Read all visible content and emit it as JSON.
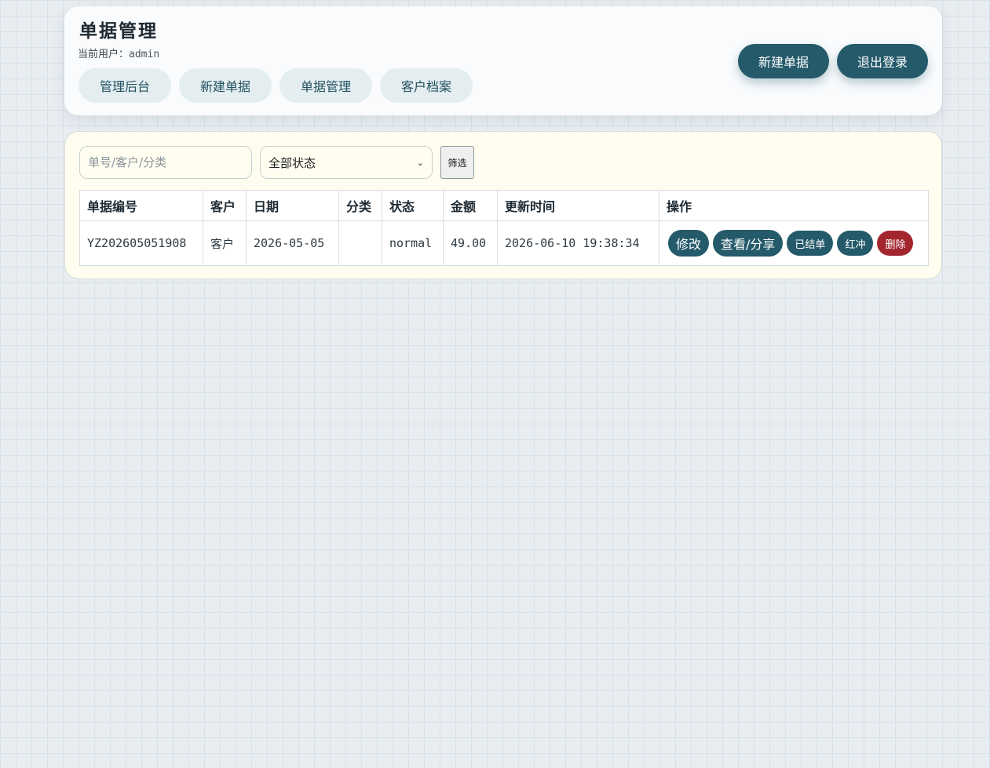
{
  "header": {
    "title": "单据管理",
    "user_label": "当前用户：",
    "user_name": "admin",
    "nav": [
      {
        "label": "管理后台"
      },
      {
        "label": "新建单据"
      },
      {
        "label": "单据管理"
      },
      {
        "label": "客户档案"
      }
    ],
    "actions": {
      "new_label": "新建单据",
      "logout_label": "退出登录"
    }
  },
  "filter": {
    "search_placeholder": "单号/客户/分类",
    "status_value": "全部状态",
    "filter_label": "筛选"
  },
  "table": {
    "columns": [
      "单据编号",
      "客户",
      "日期",
      "分类",
      "状态",
      "金额",
      "更新时间",
      "操作"
    ],
    "rows": [
      {
        "id": "YZ202605051908",
        "customer": "客户",
        "date": "2026-05-05",
        "category": "",
        "status": "normal",
        "amount": "49.00",
        "updated": "2026-06-10 19:38:34",
        "ops": {
          "edit": "修改",
          "view": "查看/分享",
          "settle": "已结单",
          "reverse": "红冲",
          "delete": "删除"
        }
      }
    ]
  },
  "colors": {
    "primary": "#245a6a",
    "danger": "#a3262f",
    "nav_bg": "#e4eef1",
    "list_bg": "#fffdf0"
  }
}
